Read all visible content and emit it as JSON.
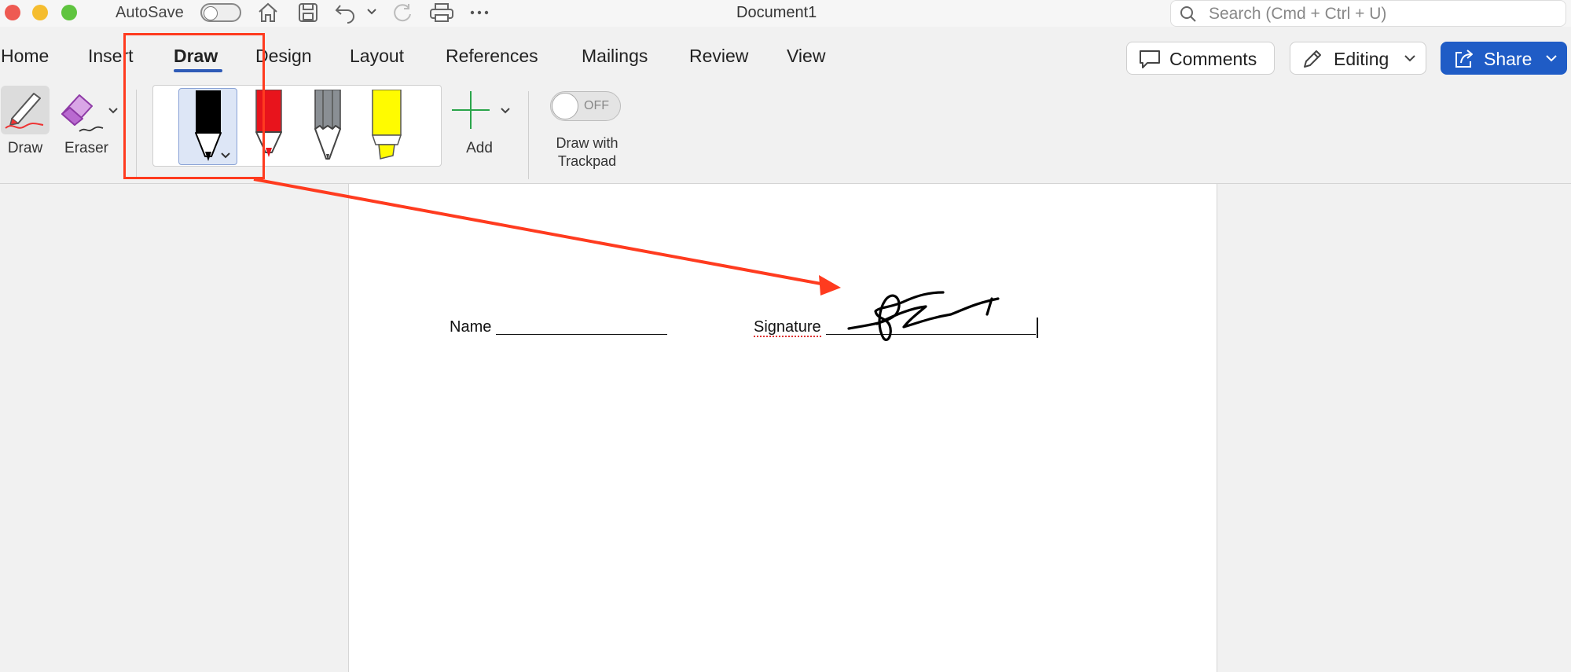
{
  "window": {
    "title": "Document1"
  },
  "titlebar": {
    "autosave_label": "AutoSave",
    "search_placeholder": "Search (Cmd + Ctrl + U)"
  },
  "tabs": [
    {
      "label": "Home"
    },
    {
      "label": "Insert"
    },
    {
      "label": "Draw",
      "active": true
    },
    {
      "label": "Design"
    },
    {
      "label": "Layout"
    },
    {
      "label": "References"
    },
    {
      "label": "Mailings"
    },
    {
      "label": "Review"
    },
    {
      "label": "View"
    }
  ],
  "actions": {
    "comments_label": "Comments",
    "editing_label": "Editing",
    "share_label": "Share"
  },
  "ribbon": {
    "draw_label": "Draw",
    "eraser_label": "Eraser",
    "add_label": "Add",
    "trackpad_toggle_state": "OFF",
    "trackpad_label_line1": "Draw with",
    "trackpad_label_line2": "Trackpad",
    "pens": [
      {
        "name": "black-pen",
        "color": "#000000",
        "selected": true
      },
      {
        "name": "red-pen",
        "color": "#e8141c"
      },
      {
        "name": "gray-pencil",
        "color": "#8a8f94"
      },
      {
        "name": "yellow-highlighter",
        "color": "#fffb00"
      }
    ]
  },
  "document": {
    "name_label": "Name",
    "signature_label": "Signature"
  },
  "annotation": {
    "color": "#ff3b1f"
  },
  "colors": {
    "accent_blue": "#1f5cc6",
    "add_green": "#2aa54a"
  }
}
